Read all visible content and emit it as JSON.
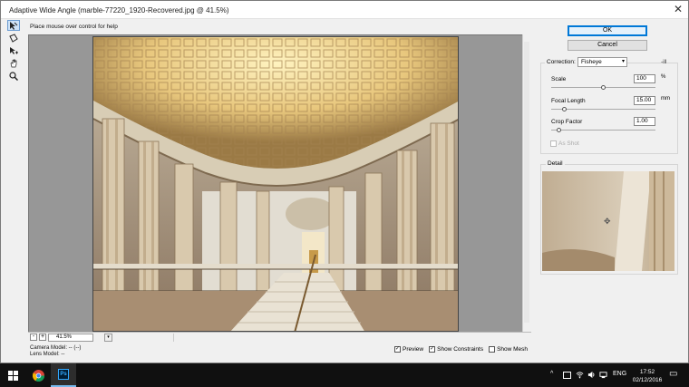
{
  "window": {
    "title": "Adaptive Wide Angle (marble-77220_1920-Recovered.jpg @ 41.5%)",
    "close_glyph": "✕"
  },
  "hint": "Place mouse over control for help",
  "tools": [
    {
      "icon": "constraint-arrow-icon",
      "active": true
    },
    {
      "icon": "polygon-constraint-icon",
      "active": false
    },
    {
      "icon": "move-tool-icon",
      "active": false
    },
    {
      "icon": "hand-icon",
      "active": false
    },
    {
      "icon": "zoom-icon",
      "active": false
    }
  ],
  "zoom": {
    "minus": "-",
    "plus": "+",
    "value": "41.5%",
    "dropdown_glyph": "▾"
  },
  "camera": {
    "model": "Camera Model: -- (--)",
    "lens": "Lens Model: --"
  },
  "checkboxes": {
    "preview": {
      "label": "Preview",
      "checked": true
    },
    "constraints": {
      "label": "Show Constraints",
      "checked": true
    },
    "mesh": {
      "label": "Show Mesh",
      "checked": false
    }
  },
  "buttons": {
    "ok": "OK",
    "cancel": "Cancel"
  },
  "correction": {
    "label": "Correction:",
    "value": "Fisheye",
    "menu_glyph": "▾",
    "extra": "-ill"
  },
  "params": {
    "scale": {
      "label": "Scale",
      "value": "100",
      "unit": "%",
      "slider": 0.5
    },
    "focal": {
      "label": "Focal Length",
      "value": "15.00",
      "unit": "mm",
      "slider": 0.13
    },
    "crop": {
      "label": "Crop Factor",
      "value": "1.00",
      "unit": "",
      "slider": 0.08
    }
  },
  "as_shot": "As Shot",
  "detail": {
    "label": "Detail",
    "crosshair": "✥"
  },
  "taskbar": {
    "lang": "ENG",
    "time": "17:52",
    "date": "02/12/2016",
    "tray_up_glyph": "^",
    "notification_glyph": "▭",
    "ps_label": "Ps"
  }
}
